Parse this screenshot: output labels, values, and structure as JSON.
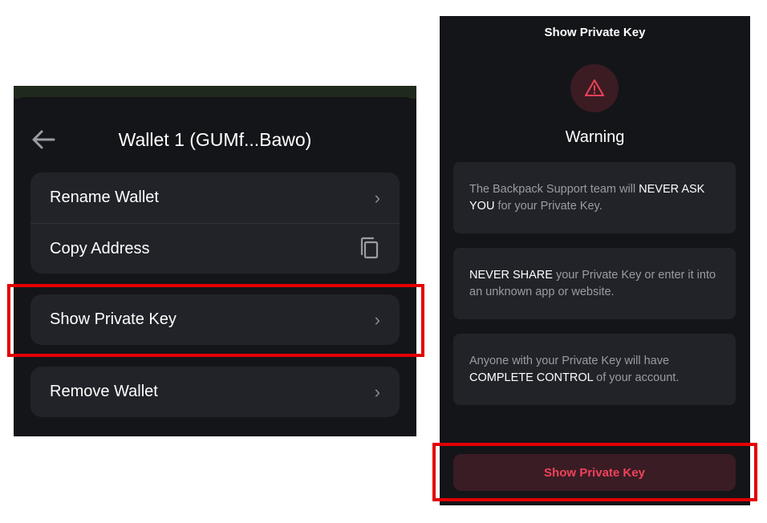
{
  "wallet_menu": {
    "title": "Wallet 1 (GUMf...Bawo)",
    "back_icon": "arrow-left-icon",
    "items": [
      {
        "label": "Rename Wallet",
        "icon": "chevron-right-icon"
      },
      {
        "label": "Copy Address",
        "icon": "copy-icon"
      },
      {
        "label": "Show Private Key",
        "icon": "chevron-right-icon"
      },
      {
        "label": "Remove Wallet",
        "icon": "chevron-right-icon"
      }
    ]
  },
  "private_key_screen": {
    "title": "Show Private Key",
    "warning_icon": "warning-triangle-icon",
    "heading": "Warning",
    "cards": [
      {
        "pre": "The Backpack Support team will ",
        "em": "NEVER ASK YOU",
        "post": " for your Private Key."
      },
      {
        "pre": "",
        "em": "NEVER SHARE",
        "post": " your Private Key or enter it into an unknown app or website."
      },
      {
        "pre": "Anyone with your Private Key will have ",
        "em": "COMPLETE CONTROL",
        "post": " of your account."
      }
    ],
    "button_label": "Show Private Key"
  },
  "colors": {
    "background": "#141519",
    "surface": "#222329",
    "danger_text": "#f0425a",
    "danger_surface": "#3a1c24",
    "highlight": "#e30000"
  }
}
